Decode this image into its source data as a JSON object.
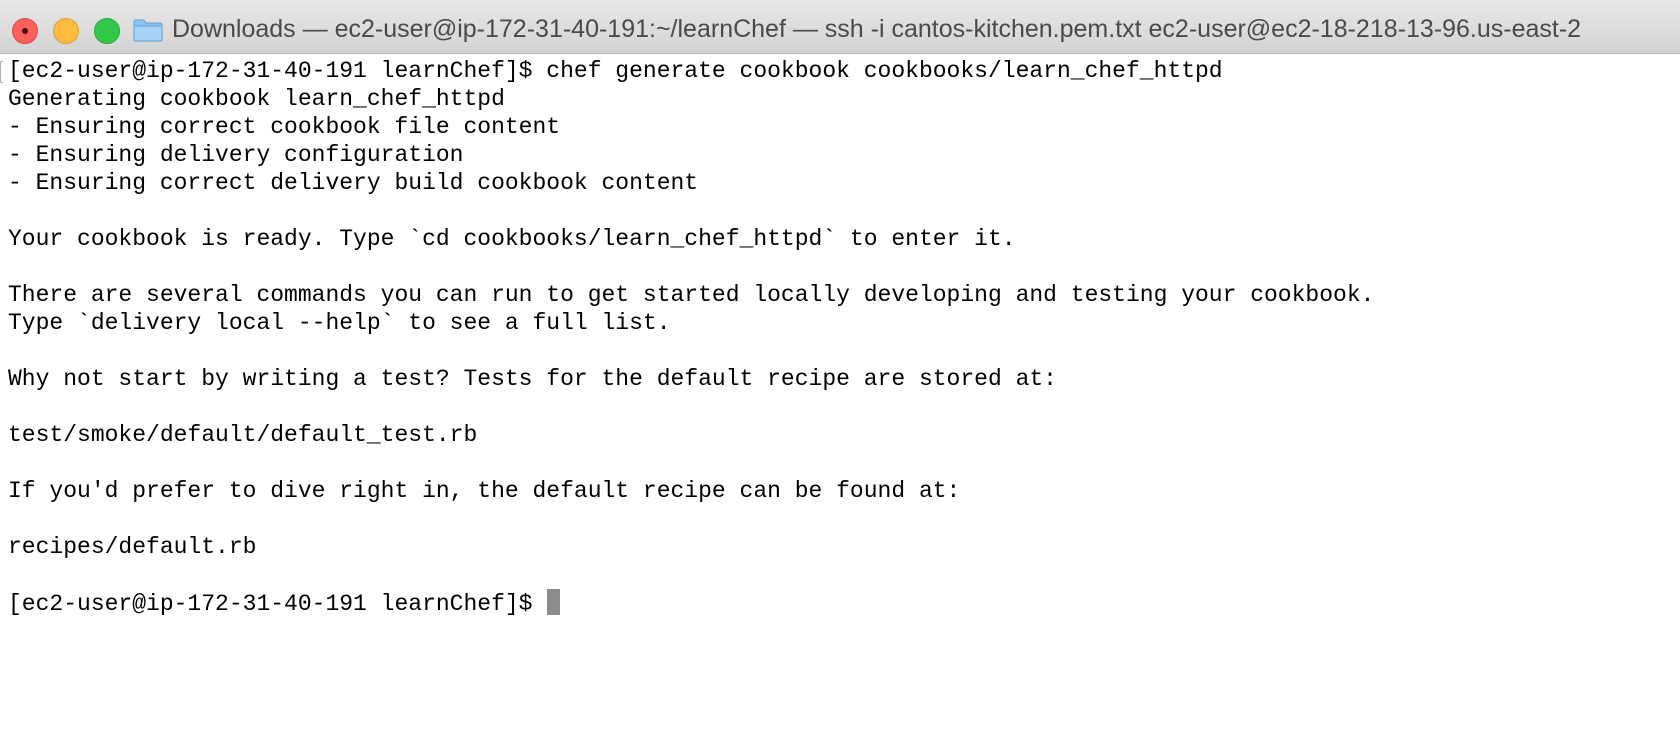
{
  "window": {
    "title": "Downloads — ec2-user@ip-172-31-40-191:~/learnChef — ssh -i cantos-kitchen.pem.txt ec2-user@ec2-18-218-13-96.us-east-2"
  },
  "colors": {
    "close": "#fc605c",
    "minimize": "#fdbc40",
    "zoom": "#34c84a",
    "terminal_bg": "#ffffff",
    "terminal_fg": "#000000",
    "cursor": "#8c8c8c"
  },
  "icons": {
    "titlebar": "folder-icon"
  },
  "terminal": {
    "lines": [
      "[ec2-user@ip-172-31-40-191 learnChef]$ chef generate cookbook cookbooks/learn_chef_httpd",
      "Generating cookbook learn_chef_httpd",
      "- Ensuring correct cookbook file content",
      "- Ensuring delivery configuration",
      "- Ensuring correct delivery build cookbook content",
      "",
      "Your cookbook is ready. Type `cd cookbooks/learn_chef_httpd` to enter it.",
      "",
      "There are several commands you can run to get started locally developing and testing your cookbook.",
      "Type `delivery local --help` to see a full list.",
      "",
      "Why not start by writing a test? Tests for the default recipe are stored at:",
      "",
      "test/smoke/default/default_test.rb",
      "",
      "If you'd prefer to dive right in, the default recipe can be found at:",
      "",
      "recipes/default.rb",
      ""
    ],
    "prompt": "[ec2-user@ip-172-31-40-191 learnChef]$"
  }
}
